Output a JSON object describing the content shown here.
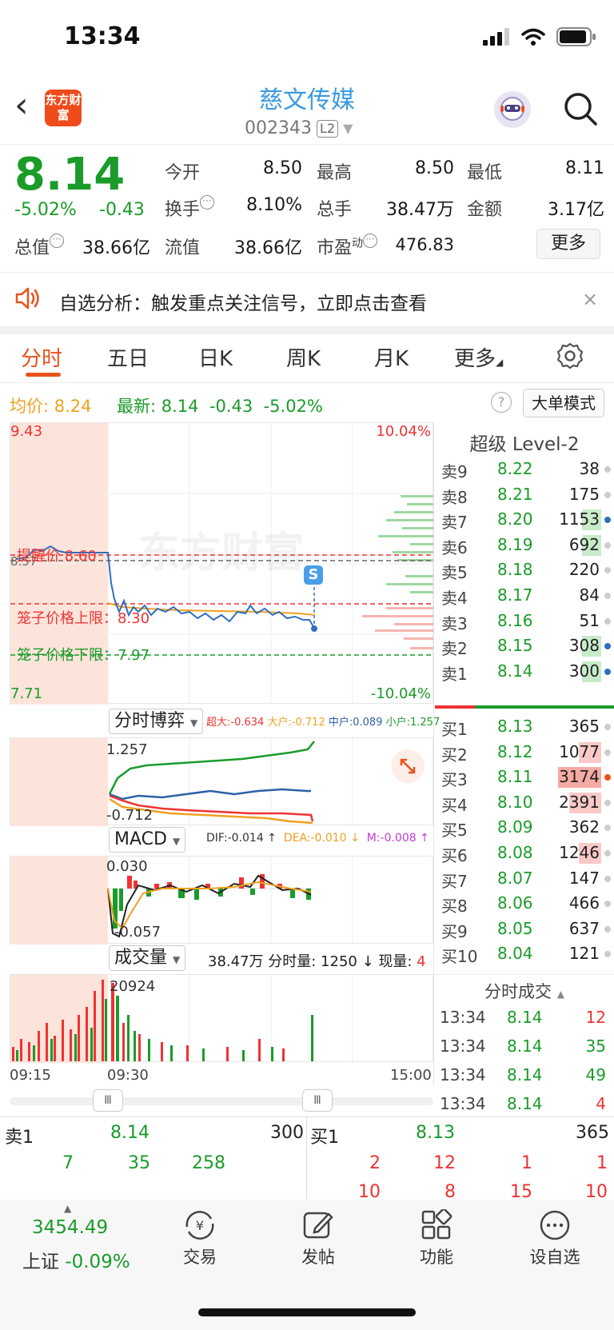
{
  "status": {
    "time": "13:34"
  },
  "header": {
    "title": "慈文传媒",
    "code": "002343",
    "level_badge": "L2",
    "logo_text": "东方财富"
  },
  "quote": {
    "price": "8.14",
    "pct": "-5.02%",
    "chg": "-0.43",
    "open_label": "今开",
    "open": "8.50",
    "high_label": "最高",
    "high": "8.50",
    "low_label": "最低",
    "low": "8.11",
    "turnover_label": "换手",
    "turnover": "8.10%",
    "volume_label": "总手",
    "volume": "38.47万",
    "amount_label": "金额",
    "amount": "3.17亿",
    "mktcap_label": "总值",
    "mktcap": "38.66亿",
    "float_label": "流值",
    "float": "38.66亿",
    "pe_label": "市盈",
    "pe_sup": "动",
    "pe": "476.83",
    "more_label": "更多"
  },
  "banner": {
    "text": "自选分析：触发重点关注信号，立即点击查看",
    "close": "×"
  },
  "tabs": [
    {
      "label": "分时"
    },
    {
      "label": "五日"
    },
    {
      "label": "日K"
    },
    {
      "label": "周K"
    },
    {
      "label": "月K"
    },
    {
      "label": "更多"
    }
  ],
  "info": {
    "avg_label": "均价:",
    "avg": "8.24",
    "latest_label": "最新:",
    "latest": "8.14",
    "chg": "-0.43",
    "pct": "-5.02%",
    "big_order_btn": "大单模式",
    "help": "?"
  },
  "main_chart": {
    "y_max": "9.43",
    "y_min": "7.71",
    "pct_max": "10.04%",
    "pct_min": "-10.04%",
    "prev_close_short": "8.57",
    "limit_label": "提醒价 8.60",
    "cage_upper": "笼子价格上限：8.30",
    "cage_lower": "笼子价格下限：7.97",
    "watermark": "东方财富",
    "s_badge": "S"
  },
  "sub1": {
    "label": "分时博弈",
    "legend": [
      {
        "name": "超大:-0.634",
        "color": "#e33"
      },
      {
        "name": "大户:-0.712",
        "color": "#f0a020"
      },
      {
        "name": "中户:0.089",
        "color": "#2f5fa8"
      },
      {
        "name": "小户:1.257",
        "color": "#1a9b2a"
      }
    ],
    "ymax": "1.257",
    "ymin": "-0.712"
  },
  "sub2": {
    "label": "MACD",
    "legend": [
      {
        "name": "DIF:-0.014 ↑",
        "color": "#333"
      },
      {
        "name": "DEA:-0.010 ↓",
        "color": "#f0a020"
      },
      {
        "name": "M:-0.008 ↑",
        "color": "#c33bd6"
      }
    ],
    "ymax": "0.030",
    "ymin": "-0.057"
  },
  "sub3": {
    "label": "成交量",
    "summary": "38.47万 分时量: 1250 ↓ 现量:",
    "now": "4",
    "ymax": "20924"
  },
  "time_axis": {
    "start": "09:15",
    "open": "09:30",
    "end": "15:00"
  },
  "slider": {
    "handle": "Ⅲ"
  },
  "order_book": {
    "title": "超级 Level-2",
    "asks": [
      {
        "label": "卖9",
        "price": "8.22",
        "vol": "38"
      },
      {
        "label": "卖8",
        "price": "8.21",
        "vol": "175"
      },
      {
        "label": "卖7",
        "price": "8.20",
        "vol": "1153"
      },
      {
        "label": "卖6",
        "price": "8.19",
        "vol": "692"
      },
      {
        "label": "卖5",
        "price": "8.18",
        "vol": "220"
      },
      {
        "label": "卖4",
        "price": "8.17",
        "vol": "84"
      },
      {
        "label": "卖3",
        "price": "8.16",
        "vol": "51"
      },
      {
        "label": "卖2",
        "price": "8.15",
        "vol": "308"
      },
      {
        "label": "卖1",
        "price": "8.14",
        "vol": "300"
      }
    ],
    "bids": [
      {
        "label": "买1",
        "price": "8.13",
        "vol": "365"
      },
      {
        "label": "买2",
        "price": "8.12",
        "vol": "1077"
      },
      {
        "label": "买3",
        "price": "8.11",
        "vol": "3174"
      },
      {
        "label": "买4",
        "price": "8.10",
        "vol": "2391"
      },
      {
        "label": "买5",
        "price": "8.09",
        "vol": "362"
      },
      {
        "label": "买6",
        "price": "8.08",
        "vol": "1246"
      },
      {
        "label": "买7",
        "price": "8.07",
        "vol": "147"
      },
      {
        "label": "买8",
        "price": "8.06",
        "vol": "466"
      },
      {
        "label": "买9",
        "price": "8.05",
        "vol": "637"
      },
      {
        "label": "买10",
        "price": "8.04",
        "vol": "121"
      }
    ]
  },
  "trades": {
    "title": "分时成交",
    "rows": [
      {
        "time": "13:34",
        "price": "8.14",
        "vol": "12"
      },
      {
        "time": "13:34",
        "price": "8.14",
        "vol": "35"
      },
      {
        "time": "13:34",
        "price": "8.14",
        "vol": "49"
      },
      {
        "time": "13:34",
        "price": "8.14",
        "vol": "4"
      }
    ]
  },
  "bottom_panel": {
    "sell1_label": "卖1",
    "sell1_price": "8.14",
    "sell1_vol": "300",
    "buy1_label": "买1",
    "buy1_price": "8.13",
    "buy1_vol": "365",
    "sell_queue": [
      "7",
      "35",
      "258"
    ],
    "buy_queue_1": [
      "2",
      "12",
      "1",
      "1"
    ],
    "buy_queue_2": [
      "10",
      "8",
      "15",
      "10"
    ]
  },
  "bottom_nav": {
    "index_value": "3454.49",
    "index_name": "上证",
    "index_pct": "-0.09%",
    "items": [
      {
        "label": "交易"
      },
      {
        "label": "发帖"
      },
      {
        "label": "功能"
      },
      {
        "label": "设自选"
      }
    ]
  },
  "colors": {
    "up": "#e33",
    "down": "#1a9b2a",
    "accent": "#e8511c",
    "title": "#3a9be0"
  }
}
